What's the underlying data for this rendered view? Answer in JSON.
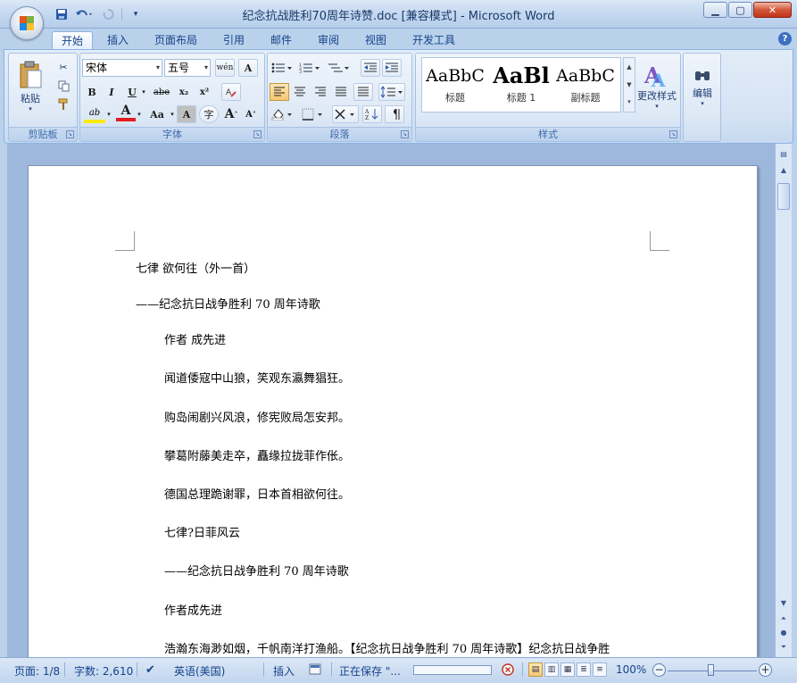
{
  "window": {
    "title": "纪念抗战胜利70周年诗赞.doc [兼容模式] - Microsoft Word",
    "minimize_icon": "minimize-icon",
    "maximize_icon": "maximize-icon",
    "close_icon": "close-icon"
  },
  "qat": {
    "save_icon": "save-icon",
    "undo_icon": "undo-icon",
    "redo_icon": "redo-icon",
    "customize_icon": "dropdown-icon"
  },
  "tabs": [
    {
      "label": "开始",
      "active": true
    },
    {
      "label": "插入"
    },
    {
      "label": "页面布局"
    },
    {
      "label": "引用"
    },
    {
      "label": "邮件"
    },
    {
      "label": "审阅"
    },
    {
      "label": "视图"
    },
    {
      "label": "开发工具"
    }
  ],
  "ribbon": {
    "clipboard": {
      "label": "剪贴板",
      "paste_label": "粘贴"
    },
    "font": {
      "label": "字体",
      "font_name": "宋体",
      "font_size": "五号",
      "bold": "B",
      "italic": "I",
      "underline": "U",
      "strike": "abe",
      "subscript": "x₂",
      "superscript": "x²",
      "highlight": "ab",
      "font_color": "A",
      "change_case": "Aa",
      "char_shading": "A",
      "enclose": "字",
      "grow": "A",
      "shrink": "A",
      "phonetic": "wén",
      "char_border": "A"
    },
    "paragraph": {
      "label": "段落"
    },
    "styles": {
      "label": "样式",
      "items": [
        {
          "sample": "AaBbC",
          "name": "标题"
        },
        {
          "sample": "AaBl",
          "name": "标题 1"
        },
        {
          "sample": "AaBbC",
          "name": "副标题"
        }
      ],
      "change_styles": "更改样式"
    },
    "editing": {
      "label": "编辑"
    }
  },
  "document": {
    "lines": [
      "七律 欲何往（外一首）",
      "——纪念抗日战争胜利 70 周年诗歌",
      "作者 成先进",
      "闻道倭寇中山狼，笑观东瀛舞猖狂。",
      "购岛闹剧兴风浪，修宪败局怎安邦。",
      "攀葛附藤美走卒，矗缘拉拢菲作伥。",
      "德国总理跪谢罪，日本首相欲何往。",
      "七律?日菲风云",
      "——纪念抗日战争胜利 70 周年诗歌",
      "作者成先进",
      "浩瀚东海渺如烟，千帆南洋打渔船。【纪念抗日战争胜利 70 周年诗歌】纪念抗日战争胜"
    ]
  },
  "status": {
    "page": "页面: 1/8",
    "words": "字数: 2,610",
    "language": "英语(美国)",
    "insert_mode": "插入",
    "saving": "正在保存 \"...",
    "zoom": "100%"
  },
  "colors": {
    "ribbon_text": "#15428b",
    "doc_background": "#9eb8dd",
    "accent_active": "#f8c770"
  }
}
